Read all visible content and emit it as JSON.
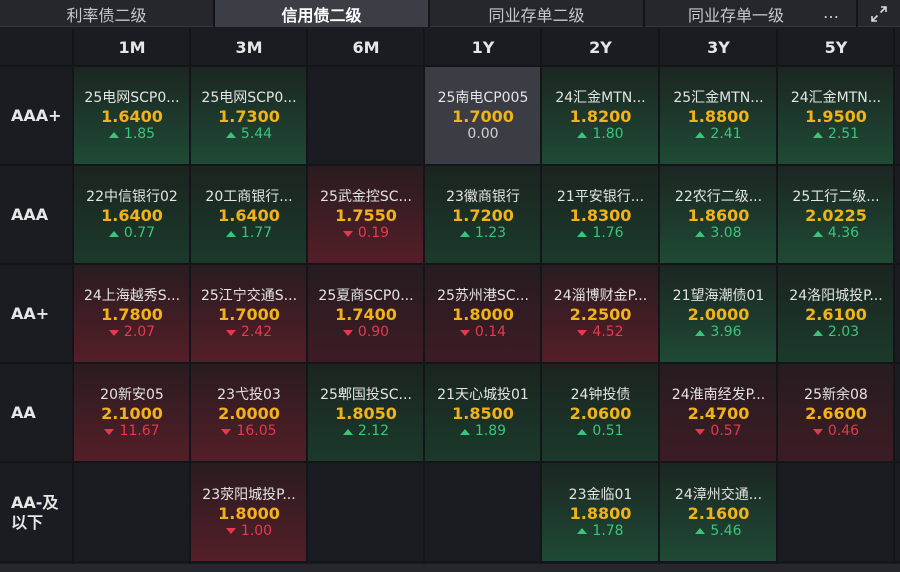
{
  "tabs": [
    {
      "label": "利率债二级",
      "active": false
    },
    {
      "label": "信用债二级",
      "active": true
    },
    {
      "label": "同业存单二级",
      "active": false
    },
    {
      "label": "同业存单一级",
      "active": false
    }
  ],
  "toolbar": {
    "more_icon": "…",
    "expand_icon": "expand-icon"
  },
  "columns": [
    "1M",
    "3M",
    "6M",
    "1Y",
    "2Y",
    "3Y",
    "5Y"
  ],
  "rows": [
    {
      "label": "AAA+",
      "cells": [
        {
          "name": "25电网SCP0...",
          "rate": "1.6400",
          "change": "1.85",
          "dir": "up",
          "tone": "g1"
        },
        {
          "name": "25电网SCP0...",
          "rate": "1.7300",
          "change": "5.44",
          "dir": "up",
          "tone": "g1"
        },
        null,
        {
          "name": "25南电CP005",
          "rate": "1.7000",
          "change": "0.00",
          "dir": "flat",
          "tone": "n"
        },
        {
          "name": "24汇金MTN...",
          "rate": "1.8200",
          "change": "1.80",
          "dir": "up",
          "tone": "g1"
        },
        {
          "name": "25汇金MTN...",
          "rate": "1.8800",
          "change": "2.41",
          "dir": "up",
          "tone": "g1"
        },
        {
          "name": "24汇金MTN...",
          "rate": "1.9500",
          "change": "2.51",
          "dir": "up",
          "tone": "g1"
        }
      ]
    },
    {
      "label": "AAA",
      "cells": [
        {
          "name": "22中信银行02",
          "rate": "1.6400",
          "change": "0.77",
          "dir": "up",
          "tone": "g2"
        },
        {
          "name": "20工商银行...",
          "rate": "1.6400",
          "change": "1.77",
          "dir": "up",
          "tone": "g2"
        },
        {
          "name": "25武金控SC...",
          "rate": "1.7550",
          "change": "0.19",
          "dir": "down",
          "tone": "r1"
        },
        {
          "name": "23徽商银行",
          "rate": "1.7200",
          "change": "1.23",
          "dir": "up",
          "tone": "g2"
        },
        {
          "name": "21平安银行...",
          "rate": "1.8300",
          "change": "1.76",
          "dir": "up",
          "tone": "g2"
        },
        {
          "name": "22农行二级...",
          "rate": "1.8600",
          "change": "3.08",
          "dir": "up",
          "tone": "g1"
        },
        {
          "name": "25工行二级...",
          "rate": "2.0225",
          "change": "4.36",
          "dir": "up",
          "tone": "g1"
        }
      ]
    },
    {
      "label": "AA+",
      "cells": [
        {
          "name": "24上海越秀S...",
          "rate": "1.7800",
          "change": "2.07",
          "dir": "down",
          "tone": "r1"
        },
        {
          "name": "25江宁交通S...",
          "rate": "1.7000",
          "change": "2.42",
          "dir": "down",
          "tone": "r1"
        },
        {
          "name": "25夏商SCP0...",
          "rate": "1.7400",
          "change": "0.90",
          "dir": "down",
          "tone": "r2"
        },
        {
          "name": "25苏州港SC...",
          "rate": "1.8000",
          "change": "0.14",
          "dir": "down",
          "tone": "r2"
        },
        {
          "name": "24淄博财金P...",
          "rate": "2.2500",
          "change": "4.52",
          "dir": "down",
          "tone": "r1"
        },
        {
          "name": "21望海潮债01",
          "rate": "2.0000",
          "change": "3.96",
          "dir": "up",
          "tone": "g1"
        },
        {
          "name": "24洛阳城投P...",
          "rate": "2.6100",
          "change": "2.03",
          "dir": "up",
          "tone": "g2"
        }
      ]
    },
    {
      "label": "AA",
      "cells": [
        {
          "name": "20新安05",
          "rate": "2.1000",
          "change": "11.67",
          "dir": "down",
          "tone": "r1"
        },
        {
          "name": "23弋投03",
          "rate": "2.0000",
          "change": "16.05",
          "dir": "down",
          "tone": "r1"
        },
        {
          "name": "25郫国投SC...",
          "rate": "1.8050",
          "change": "2.12",
          "dir": "up",
          "tone": "g2"
        },
        {
          "name": "21天心城投01",
          "rate": "1.8500",
          "change": "1.89",
          "dir": "up",
          "tone": "g2"
        },
        {
          "name": "24钟投债",
          "rate": "2.0600",
          "change": "0.51",
          "dir": "up",
          "tone": "g2"
        },
        {
          "name": "24淮南经发P...",
          "rate": "2.4700",
          "change": "0.57",
          "dir": "down",
          "tone": "r2"
        },
        {
          "name": "25新余08",
          "rate": "2.6600",
          "change": "0.46",
          "dir": "down",
          "tone": "r2"
        }
      ]
    },
    {
      "label": "AA-及\n以下",
      "cells": [
        null,
        {
          "name": "23荥阳城投P...",
          "rate": "1.8000",
          "change": "1.00",
          "dir": "down",
          "tone": "r1"
        },
        null,
        null,
        {
          "name": "23金临01",
          "rate": "1.8800",
          "change": "1.78",
          "dir": "up",
          "tone": "g1"
        },
        {
          "name": "24漳州交通...",
          "rate": "2.1600",
          "change": "5.46",
          "dir": "up",
          "tone": "g1"
        },
        null
      ]
    }
  ],
  "colors": {
    "up": "#3cc47c",
    "down": "#e8384d",
    "rate": "#f2b21a",
    "background": "#1b1c21"
  }
}
